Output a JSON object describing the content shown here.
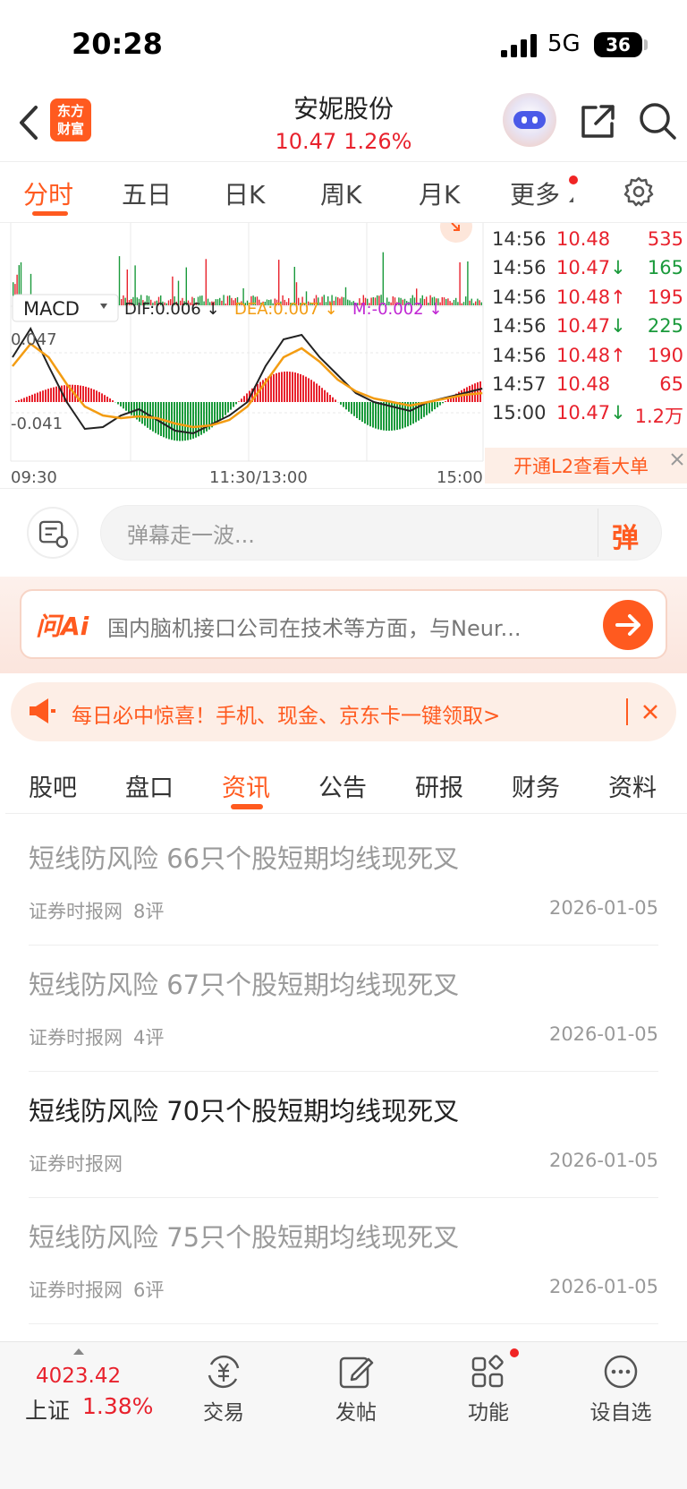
{
  "status_bar": {
    "time": "20:28",
    "network": "5G",
    "battery": "36"
  },
  "header": {
    "logo_line1": "东方",
    "logo_line2": "财富",
    "stock_name": "安妮股份",
    "price": "10.47",
    "change_pct": "1.26%",
    "icons": [
      "back-icon",
      "robot-avatar-icon",
      "share-icon",
      "search-icon"
    ]
  },
  "chart_tabs": [
    "分时",
    "五日",
    "日K",
    "周K",
    "月K",
    "更多"
  ],
  "chart": {
    "indicator": "MACD",
    "dif": "DIF:0.006 ↓",
    "dea": "DEA:0.007 ↓",
    "m": "M:-0.002 ↓",
    "ymax": "0.047",
    "ymin": "-0.041",
    "xlabels": [
      "09:30",
      "11:30/13:00",
      "15:00"
    ],
    "colors": {
      "up": "#e8222d",
      "down": "#1a9a3b",
      "dif": "#222222",
      "dea": "#f39c12",
      "m": "#c026d3"
    }
  },
  "ticks": [
    {
      "time": "14:56",
      "price": "10.48",
      "arrow": "",
      "vol": "535",
      "dir": "up"
    },
    {
      "time": "14:56",
      "price": "10.47",
      "arrow": "↓",
      "vol": "165",
      "dir": "down"
    },
    {
      "time": "14:56",
      "price": "10.48",
      "arrow": "↑",
      "vol": "195",
      "dir": "up"
    },
    {
      "time": "14:56",
      "price": "10.47",
      "arrow": "↓",
      "vol": "225",
      "dir": "down"
    },
    {
      "time": "14:56",
      "price": "10.48",
      "arrow": "↑",
      "vol": "190",
      "dir": "up"
    },
    {
      "time": "14:57",
      "price": "10.48",
      "arrow": "",
      "vol": "65",
      "dir": "up"
    },
    {
      "time": "15:00",
      "price": "10.47",
      "arrow": "↓",
      "vol": "1.2万",
      "dir": "up"
    }
  ],
  "l2_banner": "开通L2查看大单",
  "danmaku": {
    "placeholder": "弹幕走一波...",
    "send": "弹"
  },
  "ai": {
    "logo": "问Ai",
    "text": "国内脑机接口公司在技术等方面，与Neur..."
  },
  "promo": {
    "text": "每日必中惊喜！手机、现金、京东卡一键领取>"
  },
  "section_tabs": [
    "股吧",
    "盘口",
    "资讯",
    "公告",
    "研报",
    "财务",
    "资料"
  ],
  "news": [
    {
      "title": "短线防风险 66只个股短期均线现死叉",
      "source": "证券时报网",
      "comments": "8评",
      "date": "2026-01-05",
      "read": true
    },
    {
      "title": "短线防风险 67只个股短期均线现死叉",
      "source": "证券时报网",
      "comments": "4评",
      "date": "2026-01-05",
      "read": true
    },
    {
      "title": "短线防风险 70只个股短期均线现死叉",
      "source": "证券时报网",
      "comments": "",
      "date": "2026-01-05",
      "read": false
    },
    {
      "title": "短线防风险 75只个股短期均线现死叉",
      "source": "证券时报网",
      "comments": "6评",
      "date": "2026-01-05",
      "read": true
    }
  ],
  "bottom": {
    "index_value": "4023.42",
    "index_name": "上证",
    "index_pct": "1.38%",
    "nav": [
      "交易",
      "发帖",
      "功能",
      "设自选"
    ]
  }
}
